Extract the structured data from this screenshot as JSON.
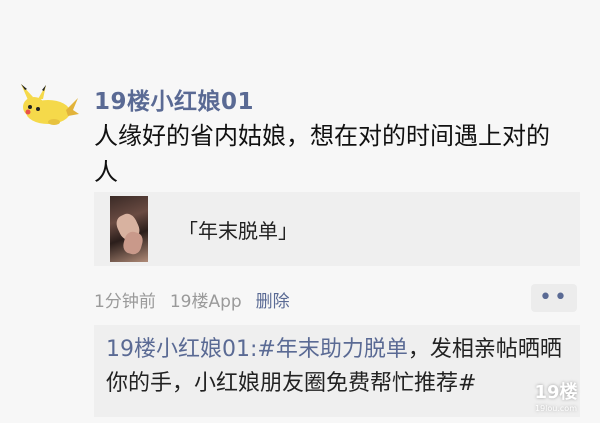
{
  "post": {
    "username": "19楼小红娘01",
    "text": "人缘好的省内姑娘，想在对的时间遇上对的人",
    "share_card": {
      "title": "「年末脱单」"
    },
    "meta": {
      "time": "1分钟前",
      "source": "19楼App",
      "delete_label": "删除"
    },
    "more_label": "••"
  },
  "comment": {
    "author": "19楼小红娘01:",
    "tag": "#年末助力脱单",
    "text": "，发相亲帖晒晒你的手，小红娘朋友圈免费帮忙推荐#"
  },
  "watermark": {
    "text": "19楼",
    "sub": "19lou.com"
  },
  "colors": {
    "link": "#5a6a94",
    "background": "#f7f7f7",
    "card": "#efefef"
  }
}
